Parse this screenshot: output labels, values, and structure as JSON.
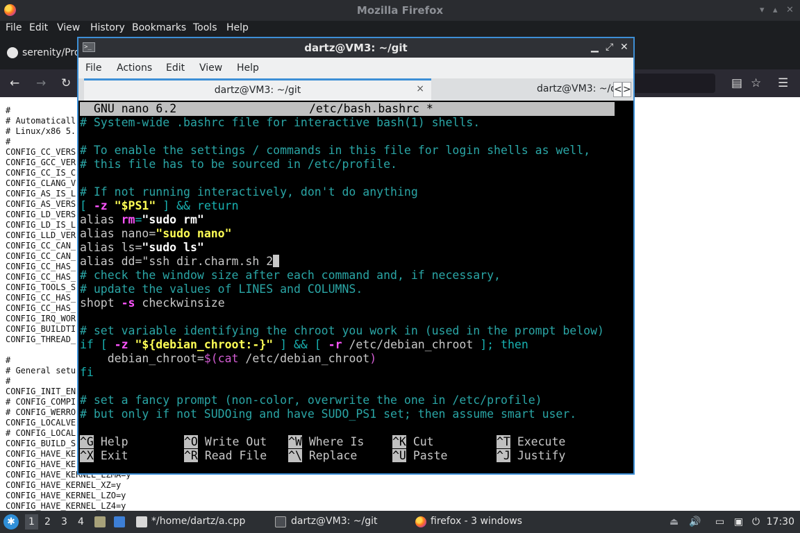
{
  "firefox": {
    "window_title": "Mozilla Firefox",
    "menu": [
      "File",
      "Edit",
      "View",
      "History",
      "Bookmarks",
      "Tools",
      "Help"
    ],
    "tab_title": "serenity/Pro",
    "content_lines": [
      "#",
      "# Automaticall",
      "# Linux/x86 5.",
      "#",
      "CONFIG_CC_VERS",
      "CONFIG_GCC_VER",
      "CONFIG_CC_IS_C",
      "CONFIG_CLANG_V",
      "CONFIG_AS_IS_L",
      "CONFIG_AS_VERS",
      "CONFIG_LD_VERS",
      "CONFIG_LD_IS_L",
      "CONFIG_LLD_VER",
      "CONFIG_CC_CAN_",
      "CONFIG_CC_CAN_",
      "CONFIG_CC_HAS_",
      "CONFIG_CC_HAS_",
      "CONFIG_TOOLS_S",
      "CONFIG_CC_HAS_",
      "CONFIG_CC_HAS_",
      "CONFIG_IRQ_WOR",
      "CONFIG_BUILDTI",
      "CONFIG_THREAD_",
      "",
      "#",
      "# General setu",
      "#",
      "CONFIG_INIT_EN",
      "# CONFIG_COMPI",
      "# CONFIG_WERRO",
      "CONFIG_LOCALVE",
      "# CONFIG_LOCAL",
      "CONFIG_BUILD_S",
      "CONFIG_HAVE_KE",
      "CONFIG_HAVE_KE",
      "CONFIG_HAVE_KERNEL_LZMA=y",
      "CONFIG_HAVE_KERNEL_XZ=y",
      "CONFIG_HAVE_KERNEL_LZO=y",
      "CONFIG_HAVE_KERNEL_LZ4=y"
    ]
  },
  "terminal": {
    "window_title": "dartz@VM3: ~/git",
    "menu": [
      "File",
      "Actions",
      "Edit",
      "View",
      "Help"
    ],
    "tabs": [
      {
        "label": "dartz@VM3: ~/git",
        "close": "×"
      },
      {
        "label": "dartz@VM3: ~/d"
      }
    ],
    "tab_scroll_left": "<",
    "tab_scroll_right": ">",
    "nano": {
      "version": "GNU nano 6.2",
      "filename": "/etc/bash.bashrc *",
      "lines": {
        "l1": "# System-wide .bashrc file for interactive bash(1) shells.",
        "l3": "# To enable the settings / commands in this file for login shells as well,",
        "l4": "# this file has to be sourced in /etc/profile.",
        "l6": "# If not running interactively, don't do anything",
        "l7a": "[ ",
        "l7b": "-z",
        "l7c": " ",
        "l7d": "\"$PS1\"",
        "l7e": " ] && return",
        "l8a": "alias ",
        "l8b": "rm",
        "l8c": "=",
        "l8d": "\"sudo rm\"",
        "l9a": "alias nano=",
        "l9b": "\"sudo nano\"",
        "l10a": "alias ls=",
        "l10b": "\"sudo ls\"",
        "l11": "alias dd=\"ssh dir.charm.sh 2",
        "l12": "# check the window size after each command and, if necessary,",
        "l13": "# update the values of LINES and COLUMNS.",
        "l14a": "shopt ",
        "l14b": "-s",
        "l14c": " checkwinsize",
        "l16": "# set variable identifying the chroot you work in (used in the prompt below)",
        "l17a": "if [ ",
        "l17b": "-z",
        "l17c": " ",
        "l17d": "\"${debian_chroot:-}\"",
        "l17e": " ] && [ ",
        "l17f": "-r",
        "l17g": " /etc/debian_chroot ",
        "l17h": "]; then",
        "l18a": "    debian_chroot=",
        "l18b": "$(",
        "l18c": "cat",
        "l18d": " /etc/debian_chroot",
        "l18e": ")",
        "l19": "fi",
        "l21": "# set a fancy prompt (non-color, overwrite the one in /etc/profile)",
        "l22": "# but only if not SUDOing and have SUDO_PS1 set; then assume smart user."
      },
      "shortcuts": [
        {
          "key": "^G",
          "label": "Help"
        },
        {
          "key": "^O",
          "label": "Write Out"
        },
        {
          "key": "^W",
          "label": "Where Is"
        },
        {
          "key": "^K",
          "label": "Cut"
        },
        {
          "key": "^T",
          "label": "Execute"
        },
        {
          "key": "^X",
          "label": "Exit"
        },
        {
          "key": "^R",
          "label": "Read File"
        },
        {
          "key": "^\\",
          "label": "Replace"
        },
        {
          "key": "^U",
          "label": "Paste"
        },
        {
          "key": "^J",
          "label": "Justify"
        }
      ]
    }
  },
  "taskbar": {
    "workspaces": [
      "1",
      "2",
      "3",
      "4"
    ],
    "tasks": [
      {
        "label": "*/home/dartz/a.cpp"
      },
      {
        "label": "dartz@VM3: ~/git"
      },
      {
        "label": "firefox - 3 windows"
      }
    ],
    "clock": "17:30"
  }
}
